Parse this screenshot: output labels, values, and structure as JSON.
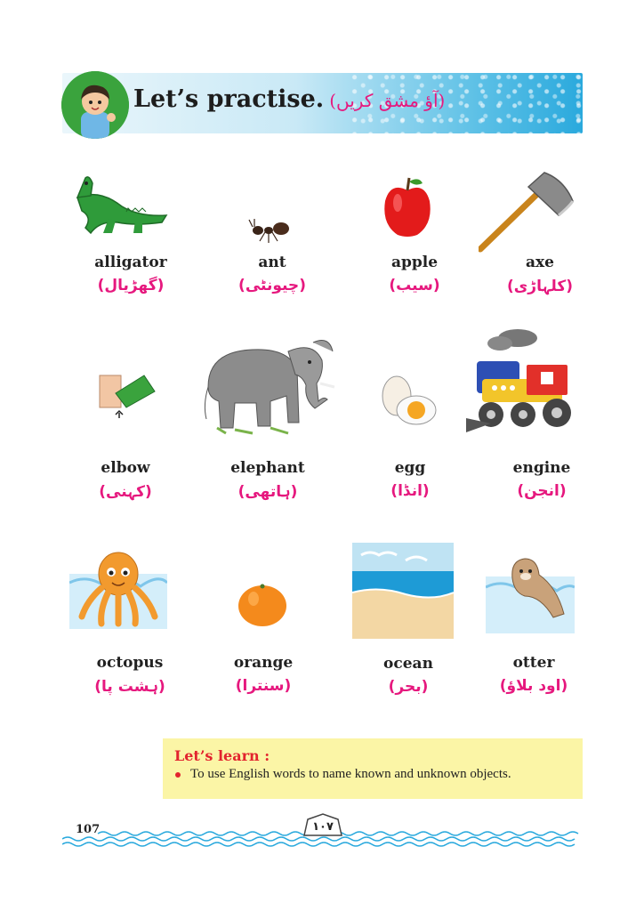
{
  "header": {
    "title": "Let’s practise.",
    "title_urdu": "(آؤ مشق کریں)"
  },
  "items": [
    {
      "word": "alligator",
      "urdu": "(گھڑیال)",
      "icon": "alligator-icon"
    },
    {
      "word": "ant",
      "urdu": "(چیونٹی)",
      "icon": "ant-icon"
    },
    {
      "word": "apple",
      "urdu": "(سیب)",
      "icon": "apple-icon"
    },
    {
      "word": "axe",
      "urdu": "(کلہاڑی)",
      "icon": "axe-icon"
    },
    {
      "word": "elbow",
      "urdu": "(کہنی)",
      "icon": "elbow-icon"
    },
    {
      "word": "elephant",
      "urdu": "(ہاتھی)",
      "icon": "elephant-icon"
    },
    {
      "word": "egg",
      "urdu": "(انڈا)",
      "icon": "egg-icon"
    },
    {
      "word": "engine",
      "urdu": "(انجن)",
      "icon": "engine-icon"
    },
    {
      "word": "octopus",
      "urdu": "(ہشت پا)",
      "icon": "octopus-icon"
    },
    {
      "word": "orange",
      "urdu": "(سنترا)",
      "icon": "orange-icon"
    },
    {
      "word": "ocean",
      "urdu": "(بحر)",
      "icon": "ocean-icon"
    },
    {
      "word": "otter",
      "urdu": "(اود بلاؤ)",
      "icon": "otter-icon"
    }
  ],
  "learn": {
    "title": "Let’s learn :",
    "point": "To use English words to name known and unknown objects."
  },
  "footer": {
    "page_number": "107",
    "page_number_urdu": "۱۰۷"
  },
  "colors": {
    "urdu_text": "#e6187e",
    "learn_title": "#e2242e",
    "learn_bg": "#fbf5a6",
    "banner": "#2aa9dd"
  }
}
